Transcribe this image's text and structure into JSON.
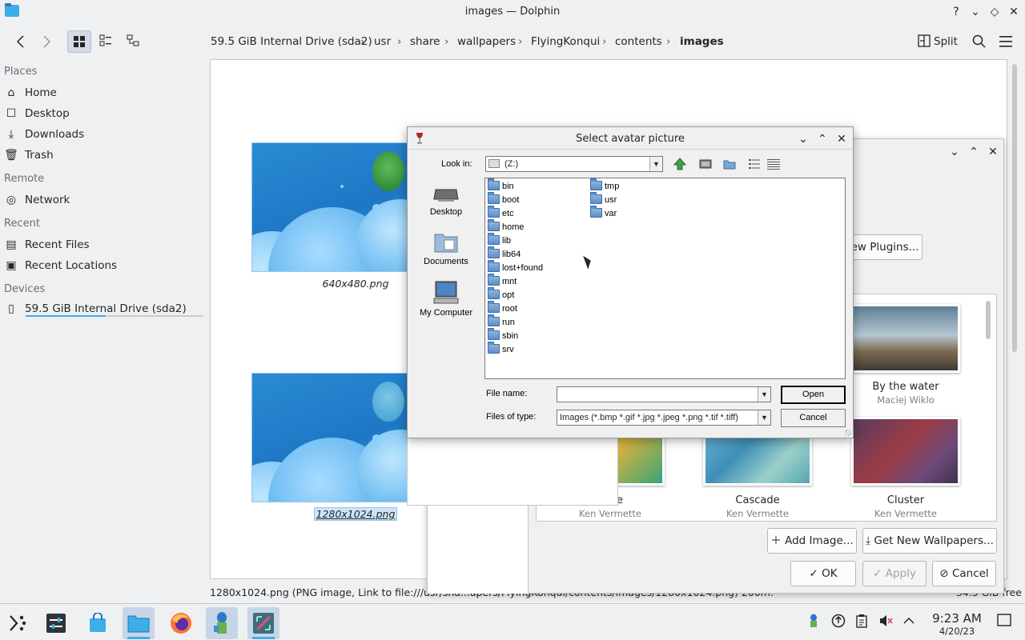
{
  "window": {
    "title": "images — Dolphin",
    "controls": [
      "?",
      "⌄",
      "◇",
      "✕"
    ]
  },
  "toolbar": {
    "back_icon": "chevron-left-icon",
    "forward_icon": "chevron-right-icon",
    "split_label": "Split",
    "breadcrumb": [
      "59.5 GiB Internal Drive (sda2)",
      "usr",
      "share",
      "wallpapers",
      "FlyingKonqui",
      "contents",
      "images"
    ]
  },
  "places": {
    "sections": [
      {
        "heading": "Places",
        "items": [
          "Home",
          "Desktop",
          "Downloads",
          "Trash"
        ]
      },
      {
        "heading": "Remote",
        "items": [
          "Network"
        ]
      },
      {
        "heading": "Recent",
        "items": [
          "Recent Files",
          "Recent Locations"
        ]
      },
      {
        "heading": "Devices",
        "items": [
          "59.5 GiB Internal Drive (sda2)"
        ]
      }
    ]
  },
  "files": [
    {
      "name": "640x480.png",
      "selected": false
    },
    {
      "name": "1280x1024.png",
      "selected": true
    }
  ],
  "statusbar": {
    "text": "1280x1024.png (PNG image, Link to file:///usr/sha...apers/FlyingKonqui/contents/images/1280x1024.png) 200m.",
    "free": "34.5 GiB free"
  },
  "wallpaper_dialog": {
    "get_plugins_label": "New Plugins...",
    "wallpapers": [
      {
        "name": "By the water",
        "author": "Maciej Wiklo"
      },
      {
        "name": "ée",
        "author": "Ken Vermette"
      },
      {
        "name": "Cascade",
        "author": "Ken Vermette"
      },
      {
        "name": "Cluster",
        "author": "Ken Vermette"
      }
    ],
    "add_image_label": "Add Image...",
    "get_new_label": "Get New Wallpapers...",
    "ok_label": "OK",
    "apply_label": "Apply",
    "cancel_label": "Cancel"
  },
  "file_dialog": {
    "title": "Select avatar picture",
    "look_in_label": "Look in:",
    "look_in_value": "(Z:)",
    "shortcuts": [
      "Desktop",
      "Documents",
      "My Computer"
    ],
    "folders_col1": [
      "bin",
      "boot",
      "etc",
      "home",
      "lib",
      "lib64",
      "lost+found",
      "mnt",
      "opt",
      "root",
      "run",
      "sbin",
      "srv"
    ],
    "folders_col2": [
      "tmp",
      "usr",
      "var"
    ],
    "file_name_label": "File name:",
    "file_name_value": "",
    "files_of_type_label": "Files of type:",
    "files_of_type_value": "Images (*.bmp *.gif *.jpg *.jpeg *.png *.tif *.tiff)",
    "open_label": "Open",
    "cancel_label": "Cancel"
  },
  "taskbar": {
    "time": "9:23 AM",
    "date": "4/20/23"
  },
  "colors": {
    "accent": "#3daee9",
    "window_bg": "#eff0f1",
    "selection": "#cde5f7"
  }
}
